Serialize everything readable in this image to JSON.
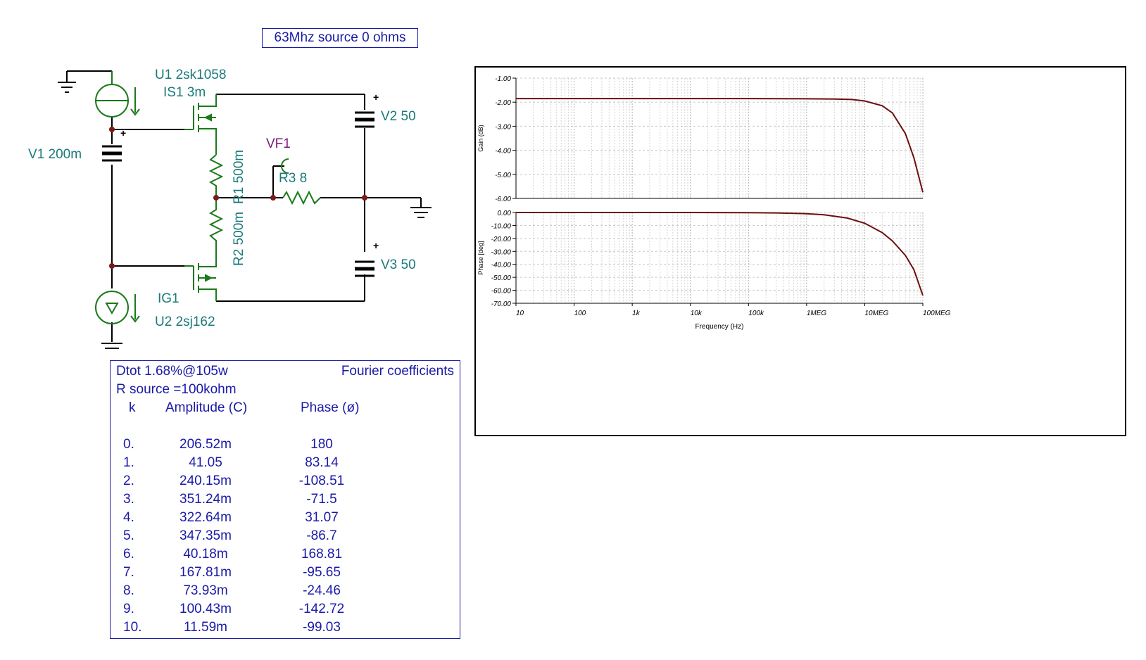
{
  "title_box": "63Mhz source 0 ohms",
  "schematic": {
    "u1_label": "U1 2sk1058",
    "is1_label": "IS1 3m",
    "v1_label": "V1 200m",
    "v2_label": "V2 50",
    "v3_label": "V3 50",
    "vf1_label": "VF1",
    "r3_label": "R3 8",
    "r1_label": "R1 500m",
    "r2_label": "R2 500m",
    "ig1_label": "IG1",
    "u2_label": "U2 2sj162",
    "plus": "+"
  },
  "fourier": {
    "dtot": "Dtot  1.68%@105w",
    "title": "Fourier coefficients",
    "rsource": "R source =100kohm",
    "col_k": "k",
    "col_amp": "Amplitude (C)",
    "col_phase": "Phase (ø)",
    "rows": [
      {
        "k": "0.",
        "amp": "206.52m",
        "phase": "180"
      },
      {
        "k": "1.",
        "amp": "41.05",
        "phase": "83.14"
      },
      {
        "k": "2.",
        "amp": "240.15m",
        "phase": "-108.51"
      },
      {
        "k": "3.",
        "amp": "351.24m",
        "phase": "-71.5"
      },
      {
        "k": "4.",
        "amp": "322.64m",
        "phase": "31.07"
      },
      {
        "k": "5.",
        "amp": "347.35m",
        "phase": "-86.7"
      },
      {
        "k": "6.",
        "amp": "40.18m",
        "phase": "168.81"
      },
      {
        "k": "7.",
        "amp": "167.81m",
        "phase": "-95.65"
      },
      {
        "k": "8.",
        "amp": "73.93m",
        "phase": "-24.46"
      },
      {
        "k": "9.",
        "amp": "100.43m",
        "phase": "-142.72"
      },
      {
        "k": "10.",
        "amp": "11.59m",
        "phase": "-99.03"
      }
    ]
  },
  "chart_data": [
    {
      "type": "line",
      "ylabel": "Gain (dB)",
      "xlabel": "",
      "x_scale": "log",
      "xlim": [
        10,
        100000000
      ],
      "ylim": [
        -6.0,
        -1.0
      ],
      "yticks": [
        "-1.00",
        "-2.00",
        "-3.00",
        "-4.00",
        "-5.00",
        "-6.00"
      ],
      "grid": true,
      "line_color": "#6b0f0f",
      "series": [
        {
          "x": [
            10,
            100,
            1000,
            10000,
            100000,
            1000000,
            3000000,
            6000000,
            10000000,
            20000000,
            30000000,
            50000000,
            70000000,
            100000000
          ],
          "y": [
            -1.85,
            -1.85,
            -1.85,
            -1.85,
            -1.85,
            -1.86,
            -1.87,
            -1.89,
            -1.95,
            -2.15,
            -2.45,
            -3.3,
            -4.3,
            -5.75
          ]
        }
      ]
    },
    {
      "type": "line",
      "ylabel": "Phase [deg]",
      "xlabel": "Frequency (Hz)",
      "x_scale": "log",
      "xlim": [
        10,
        100000000
      ],
      "ylim": [
        -70.0,
        0.0
      ],
      "yticks": [
        "0.00",
        "-10.00",
        "-20.00",
        "-30.00",
        "-40.00",
        "-50.00",
        "-60.00",
        "-70.00"
      ],
      "xticks": [
        "10",
        "100",
        "1k",
        "10k",
        "100k",
        "1MEG",
        "10MEG",
        "100MEG"
      ],
      "grid": true,
      "line_color": "#6b0f0f",
      "series": [
        {
          "x": [
            10,
            100,
            1000,
            10000,
            100000,
            300000,
            1000000,
            2000000,
            5000000,
            10000000,
            20000000,
            30000000,
            50000000,
            70000000,
            100000000
          ],
          "y": [
            0,
            0,
            0,
            0,
            -0.1,
            -0.3,
            -0.9,
            -1.8,
            -4.3,
            -8.3,
            -15.5,
            -22,
            -33,
            -44,
            -64
          ]
        }
      ]
    }
  ]
}
